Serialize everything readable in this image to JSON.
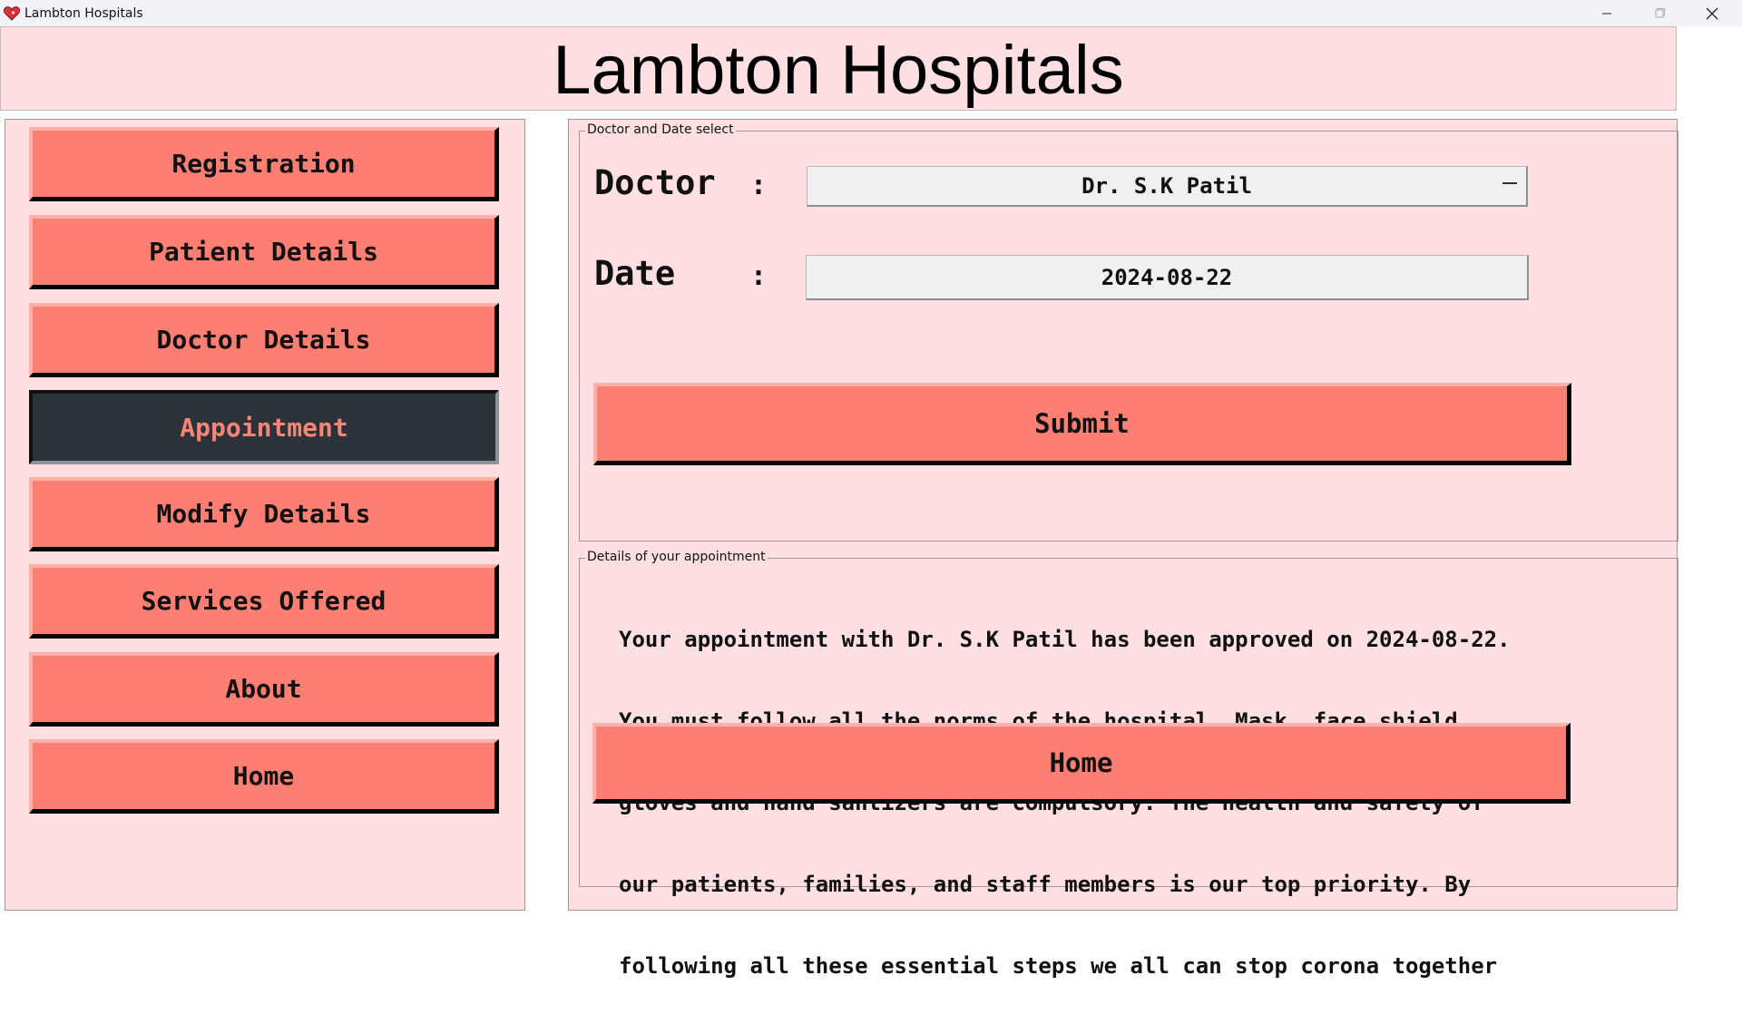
{
  "window": {
    "title": "Lambton Hospitals",
    "icon": "heart-icon",
    "controls": [
      "minimize-icon",
      "maximize-icon",
      "close-icon"
    ]
  },
  "header": {
    "title": "Lambton Hospitals"
  },
  "sidebar": {
    "items": [
      {
        "label": "Registration",
        "active": false
      },
      {
        "label": "Patient Details",
        "active": false
      },
      {
        "label": "Doctor Details",
        "active": false
      },
      {
        "label": "Appointment",
        "active": true
      },
      {
        "label": "Modify Details",
        "active": false
      },
      {
        "label": "Services Offered",
        "active": false
      },
      {
        "label": "About",
        "active": false
      },
      {
        "label": "Home",
        "active": false
      }
    ]
  },
  "selection_group": {
    "label": "Doctor and Date select",
    "doctor_label": "Doctor",
    "doctor_colon": ":",
    "doctor_value": "Dr. S.K Patil",
    "date_label": "Date",
    "date_colon": ":",
    "date_value": "2024-08-22",
    "submit_label": "Submit"
  },
  "details_group": {
    "label": "Details of your appointment",
    "lines": [
      "Your appointment with Dr. S.K Patil has been approved on 2024-08-22.",
      "You must follow all the norms of the hospital. Mask, face shield,",
      "gloves and hand santizers are compulsory. The health and safety of",
      "our patients, families, and staff members is our top priority. By",
      "following all these essential steps we all can stop corona together"
    ],
    "home_label": "Home"
  },
  "colors": {
    "background": "#ffe0e2",
    "button": "#fd7f74",
    "active_button": "#2b3238",
    "active_text": "#f7857a"
  }
}
